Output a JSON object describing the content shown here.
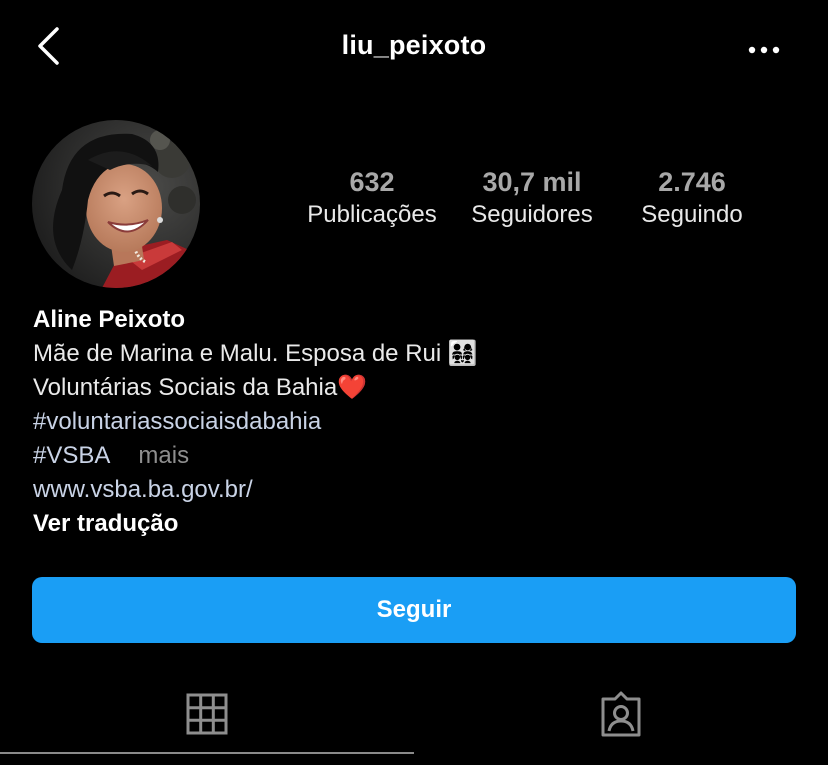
{
  "header": {
    "username": "liu_peixoto",
    "back_icon": "chevron-left-icon",
    "more_icon": "more-horizontal-icon"
  },
  "profile": {
    "avatar_icon": "profile-photo",
    "stats": [
      {
        "value": "632",
        "label": "Publicações"
      },
      {
        "value": "30,7 mil",
        "label": "Seguidores"
      },
      {
        "value": "2.746",
        "label": "Seguindo"
      }
    ]
  },
  "bio": {
    "name": "Aline Peixoto",
    "line1": "Mãe de Marina e Malu. Esposa de Rui 👨‍👩‍👧‍👧",
    "line2": "Voluntárias Sociais da Bahia❤️",
    "hashtag1": "#voluntariassociaisdabahia",
    "hashtag2": "#VSBA",
    "more_label": "mais",
    "website": "www.vsba.ba.gov.br/",
    "translate_label": "Ver tradução"
  },
  "actions": {
    "follow_label": "Seguir",
    "follow_color": "#1a9ef5"
  },
  "tabs": [
    {
      "icon": "grid-icon",
      "active": true
    },
    {
      "icon": "tagged-person-icon",
      "active": false
    }
  ]
}
